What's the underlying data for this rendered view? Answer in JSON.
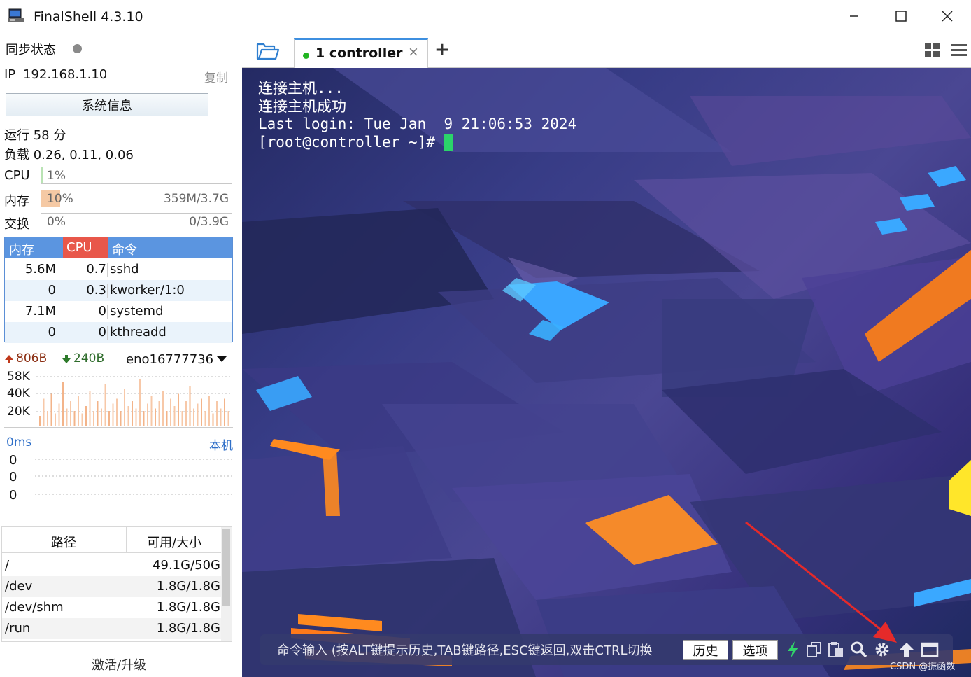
{
  "window": {
    "title": "FinalShell 4.3.10"
  },
  "sidebar": {
    "sync_status_label": "同步状态",
    "ip_label": "IP",
    "ip_value": "192.168.1.10",
    "copy_label": "复制",
    "sysinfo_button": "系统信息",
    "uptime": "运行 58 分",
    "load": "负载 0.26, 0.11, 0.06",
    "cpu": {
      "label": "CPU",
      "percent_text": "1%",
      "fraction": 0.01
    },
    "mem": {
      "label": "内存",
      "percent_text": "10%",
      "amount": "359M/3.7G",
      "fraction": 0.1
    },
    "swap": {
      "label": "交换",
      "percent_text": "0%",
      "amount": "0/3.9G",
      "fraction": 0.0
    },
    "process_table": {
      "headers": [
        "内存",
        "CPU",
        "命令"
      ],
      "rows": [
        {
          "mem": "5.6M",
          "cpu": "0.7",
          "cmd": "sshd"
        },
        {
          "mem": "0",
          "cpu": "0.3",
          "cmd": "kworker/1:0"
        },
        {
          "mem": "7.1M",
          "cpu": "0",
          "cmd": "systemd"
        },
        {
          "mem": "0",
          "cpu": "0",
          "cmd": "kthreadd"
        }
      ]
    },
    "network": {
      "up": "806B",
      "down": "240B",
      "interface": "eno16777736",
      "y_ticks": [
        "58K",
        "40K",
        "20K"
      ]
    },
    "ping": {
      "latency": "0ms",
      "target": "本机",
      "y_ticks": [
        "0",
        "0",
        "0"
      ]
    },
    "disk_table": {
      "headers": [
        "路径",
        "可用/大小"
      ],
      "rows": [
        {
          "path": "/",
          "size": "49.1G/50G"
        },
        {
          "path": "/dev",
          "size": "1.8G/1.8G"
        },
        {
          "path": "/dev/shm",
          "size": "1.8G/1.8G"
        },
        {
          "path": "/run",
          "size": "1.8G/1.8G"
        }
      ]
    },
    "upgrade_link": "激活/升级"
  },
  "tabs": {
    "items": [
      {
        "label": "1 controller",
        "status": "connected"
      }
    ]
  },
  "terminal": {
    "lines": [
      "连接主机...",
      "连接主机成功",
      "Last login: Tue Jan  9 21:06:53 2024",
      "[root@controller ~]# "
    ]
  },
  "command_bar": {
    "placeholder": "命令输入 (按ALT键提示历史,TAB键路径,ESC键返回,双击CTRL切换",
    "history_button": "历史",
    "options_button": "选项"
  },
  "watermark": "CSDN @振函数",
  "colors": {
    "tab_accent": "#3d8fe0",
    "status_green": "#22b522",
    "cursor_green": "#2bd46a",
    "table_header_blue": "#5b95e0",
    "table_header_red": "#e8574a",
    "mem_fill": "#f5c9a4",
    "arrow_red": "#e52a2a"
  }
}
